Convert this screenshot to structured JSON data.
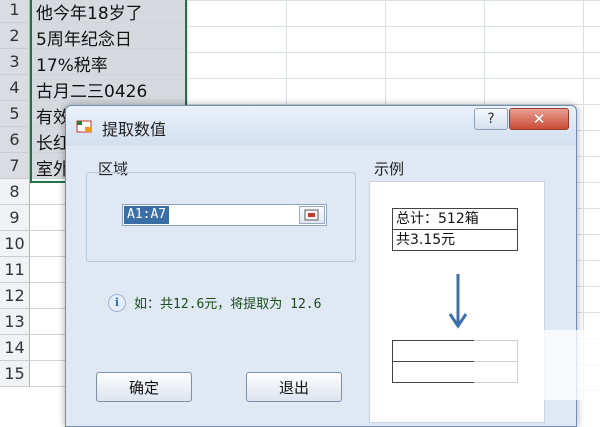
{
  "sheet": {
    "rows": [
      {
        "num": "1",
        "a": "他今年18岁了"
      },
      {
        "num": "2",
        "a": "5周年纪念日"
      },
      {
        "num": "3",
        "a": "17%税率"
      },
      {
        "num": "4",
        "a": "古月二三0426"
      },
      {
        "num": "5",
        "a": "有效"
      },
      {
        "num": "6",
        "a": "长红"
      },
      {
        "num": "7",
        "a": "室外"
      },
      {
        "num": "8",
        "a": ""
      },
      {
        "num": "9",
        "a": ""
      },
      {
        "num": "10",
        "a": ""
      },
      {
        "num": "11",
        "a": ""
      },
      {
        "num": "12",
        "a": ""
      },
      {
        "num": "13",
        "a": ""
      },
      {
        "num": "14",
        "a": ""
      },
      {
        "num": "15",
        "a": ""
      }
    ]
  },
  "dialog": {
    "title": "提取数值",
    "help_label": "?",
    "close_label": "✕",
    "area_label": "区域",
    "range_value": "A1:A7",
    "info_text": "如：共12.6元，将提取为 12.6",
    "ok_label": "确定",
    "exit_label": "退出",
    "example_label": "示例",
    "example_cells": [
      "总计：512箱",
      "共3.15元",
      "",
      ""
    ]
  },
  "colors": {
    "selection": "#217346",
    "accent": "#3a6ea5",
    "arrow": "#3c6fa8"
  },
  "icons": {
    "app": "table-icon",
    "info": "info-icon",
    "range_picker": "range-picker-icon",
    "arrow": "arrow-down-icon"
  }
}
